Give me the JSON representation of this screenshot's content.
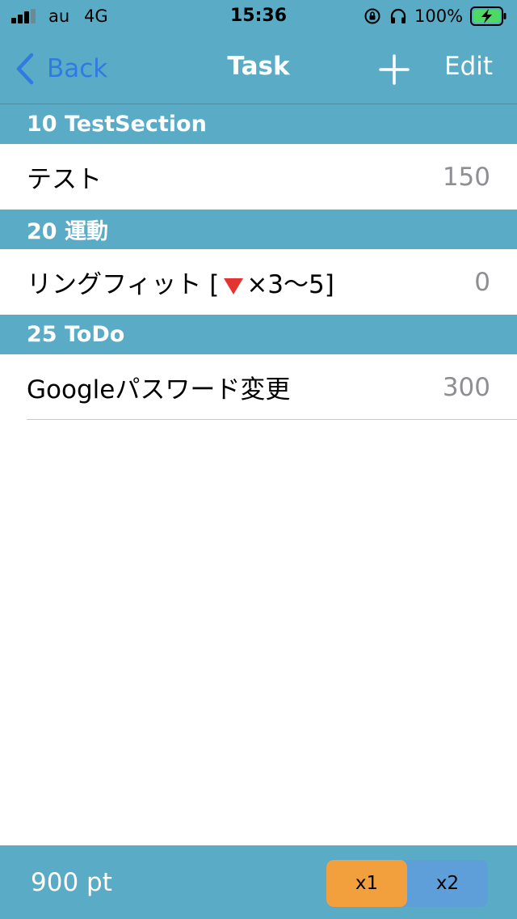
{
  "status_bar": {
    "carrier": "au",
    "network": "4G",
    "time": "15:36",
    "battery": "100%"
  },
  "nav": {
    "back_label": "Back",
    "title": "Task",
    "edit_label": "Edit"
  },
  "sections": [
    {
      "header": "10 TestSection",
      "rows": [
        {
          "title": "テスト",
          "value": "150"
        }
      ]
    },
    {
      "header": "20 運動",
      "rows": [
        {
          "title_pre": "リングフィット [",
          "title_post": "×3～5]",
          "value": "0"
        }
      ]
    },
    {
      "header": "25 ToDo",
      "rows": [
        {
          "title": "Googleパスワード変更",
          "value": "300"
        }
      ]
    }
  ],
  "bottom": {
    "points": "900 pt",
    "multipliers": [
      "x1",
      "x2"
    ],
    "selected": "x1"
  },
  "colors": {
    "bar_bg": "#5aabc6",
    "back_blue": "#2f7be0",
    "selected_segment": "#f2a03d",
    "unselected_segment": "#5f9fd9",
    "value_gray": "#8e8e93"
  },
  "icons": [
    "back-chevron-icon",
    "add-icon",
    "rotation-lock-icon",
    "headphones-icon",
    "battery-charging-icon",
    "signal-bars-icon",
    "red-triangle-icon"
  ]
}
